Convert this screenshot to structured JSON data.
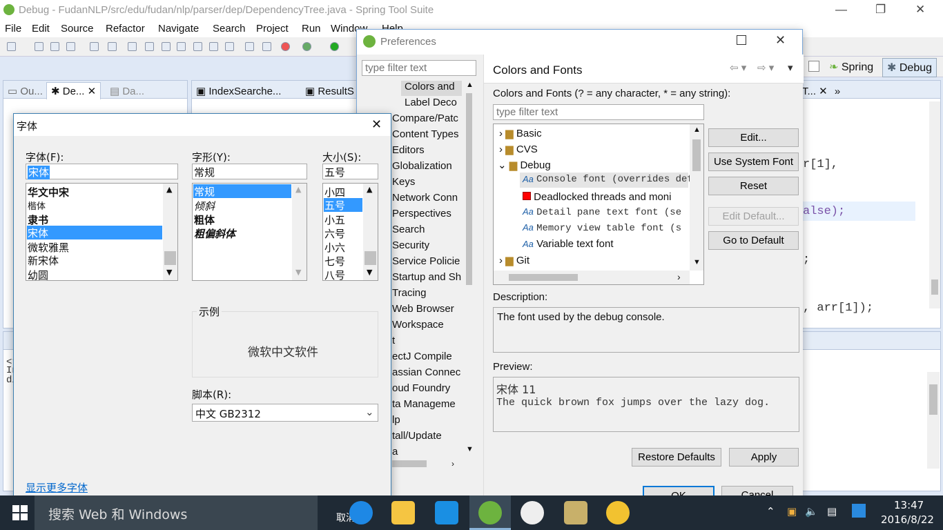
{
  "ide": {
    "title": "Debug - FudanNLP/src/edu/fudan/nlp/parser/dep/DependencyTree.java - Spring Tool Suite",
    "menu": [
      "File",
      "Edit",
      "Source",
      "Refactor",
      "Navigate",
      "Search",
      "Project",
      "Run",
      "Window",
      "Help"
    ],
    "left_tabs": [
      "Ou...",
      "De...",
      "Da..."
    ],
    "editor_tabs": [
      "IndexSearche...",
      "ResultS"
    ],
    "right_tab_partial": "T...",
    "perspectives": {
      "spring": "Spring",
      "debug": "Debug"
    },
    "code_fragments": [
      "r[1],",
      "alse);",
      ";",
      ", arr[1]);"
    ],
    "console_fragments": [
      "<t",
      "In",
      "di"
    ]
  },
  "prefs": {
    "title": "Preferences",
    "filter_placeholder": "type filter text",
    "nav_items": [
      "Colors and",
      "Label Deco",
      "Compare/Patc",
      "Content Types",
      "Editors",
      "Globalization",
      "Keys",
      "Network Conn",
      "Perspectives",
      "Search",
      "Security",
      "Service Policie",
      "Startup and Sh",
      "Tracing",
      "Web Browser",
      "Workspace",
      "t",
      "ectJ Compile",
      "assian Connec",
      "oud Foundry",
      "ta Manageme",
      "lp",
      "tall/Update",
      "a"
    ],
    "page_title": "Colors and Fonts",
    "section_label": "Colors and Fonts (? = any character, * = any string):",
    "tree_filter_placeholder": "type filter text",
    "tree": [
      {
        "label": "Basic",
        "kind": "folder",
        "expanded": false
      },
      {
        "label": "CVS",
        "kind": "folder",
        "expanded": false
      },
      {
        "label": "Debug",
        "kind": "folder",
        "expanded": true
      },
      {
        "label": "Console font (overrides defa",
        "kind": "font",
        "mono": true,
        "selected": true
      },
      {
        "label": "Deadlocked threads and moni",
        "kind": "color",
        "mono": false
      },
      {
        "label": "Detail pane text font (se",
        "kind": "font",
        "mono": true
      },
      {
        "label": "Memory view table font (s",
        "kind": "font",
        "mono": true
      },
      {
        "label": "Variable text font",
        "kind": "font",
        "mono": false
      },
      {
        "label": "Git",
        "kind": "folder",
        "expanded": false
      }
    ],
    "buttons": {
      "edit": "Edit...",
      "use_system": "Use System Font",
      "reset": "Reset",
      "edit_default": "Edit Default...",
      "go_default": "Go to Default"
    },
    "description_label": "Description:",
    "description": "The font used by the debug console.",
    "preview_label": "Preview:",
    "preview_line1": "宋体 11",
    "preview_line2": "The quick brown fox jumps over the lazy dog.",
    "restore": "Restore Defaults",
    "apply": "Apply",
    "ok": "OK",
    "cancel": "Cancel"
  },
  "fontdlg": {
    "title": "字体",
    "font_label": "字体(F):",
    "font_value": "宋体",
    "fonts": [
      "华文中宋",
      "楷体",
      "隶书",
      "宋体",
      "微软雅黑",
      "新宋体",
      "幼圆"
    ],
    "selected_font": 3,
    "style_label": "字形(Y):",
    "style_value": "常规",
    "styles": [
      "常规",
      "倾斜",
      "粗体",
      "粗偏斜体"
    ],
    "size_label": "大小(S):",
    "size_value": "五号",
    "sizes": [
      "小四",
      "五号",
      "小五",
      "六号",
      "小六",
      "七号",
      "八号"
    ],
    "selected_size": 1,
    "sample_label": "示例",
    "sample_text": "微软中文软件",
    "script_label": "脚本(R):",
    "script_value": "中文 GB2312",
    "more_fonts": "显示更多字体",
    "cancel_partial": "取消"
  },
  "taskbar": {
    "search": "搜索 Web 和 Windows",
    "time": "13:47",
    "date": "2016/8/22"
  },
  "colors": {
    "selection": "#3399ff",
    "accent": "#0078d7",
    "taskbar": "#1f2a35"
  }
}
